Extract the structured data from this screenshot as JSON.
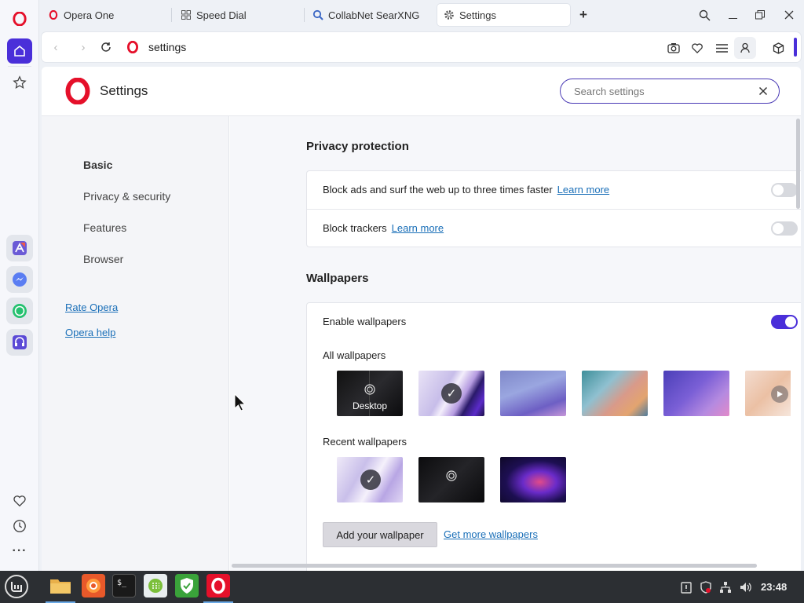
{
  "colors": {
    "accent": "#4a2fd9",
    "opera_red": "#e5102a",
    "link": "#1a6fb8"
  },
  "sidebar": {
    "top_icons": [
      "opera-logo-icon",
      "home-icon",
      "star-icon"
    ],
    "apps": [
      "aria-icon",
      "messenger-icon",
      "whatsapp-icon",
      "music-player-icon"
    ],
    "bottom_icons": [
      "heart-icon",
      "history-icon",
      "more-icon"
    ]
  },
  "tabs": [
    {
      "label": "Opera One",
      "icon": "opera-logo-icon"
    },
    {
      "label": "Speed Dial",
      "icon": "grid-icon"
    },
    {
      "label": "CollabNet SearXNG",
      "icon": "search-icon"
    },
    {
      "label": "Settings",
      "icon": "gear-icon",
      "active": true
    }
  ],
  "address": {
    "url": "settings"
  },
  "page": {
    "title": "Settings",
    "search_placeholder": "Search settings"
  },
  "nav": {
    "items": [
      "Basic",
      "Privacy & security",
      "Features",
      "Browser"
    ],
    "active": "Basic",
    "links": [
      "Rate Opera",
      "Opera help"
    ]
  },
  "privacy": {
    "title": "Privacy protection",
    "rows": [
      {
        "text": "Block ads and surf the web up to three times faster",
        "link": "Learn more",
        "enabled": false
      },
      {
        "text": "Block trackers",
        "link": "Learn more",
        "enabled": false
      }
    ]
  },
  "wallpapers": {
    "title": "Wallpapers",
    "enable_label": "Enable wallpapers",
    "enabled": true,
    "all_label": "All wallpapers",
    "desktop_label": "Desktop",
    "recent_label": "Recent wallpapers",
    "add_button": "Add your wallpaper",
    "get_more_link": "Get more wallpapers"
  },
  "taskbar": {
    "apps": [
      "mint-menu-icon",
      "files-icon",
      "firefox-icon",
      "terminal-icon",
      "calculator-icon",
      "shield-icon",
      "opera-icon"
    ],
    "clock": "23:48"
  }
}
